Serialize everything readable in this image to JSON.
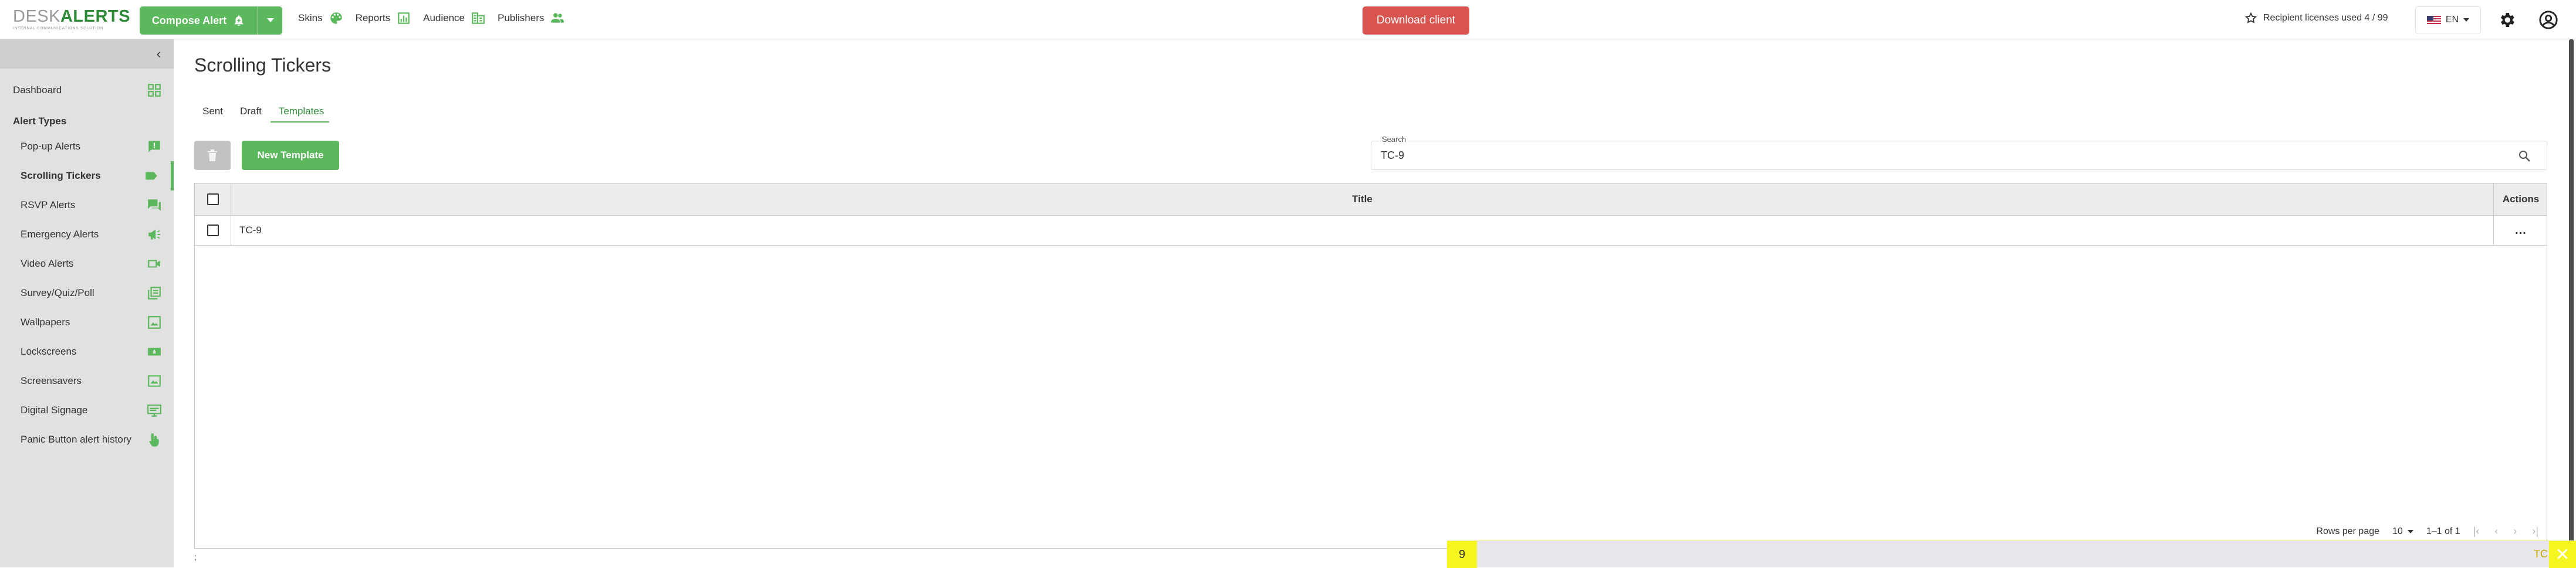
{
  "brand": {
    "logo_desk": "DESK",
    "logo_alerts": "ALERTS",
    "tagline": "INTERNAL COMMUNICATIONS SOLUTION",
    "accent": "#5cb85c",
    "danger": "#d9534f"
  },
  "topbar": {
    "compose_label": "Compose Alert",
    "nav": [
      {
        "label": "Skins",
        "icon": "palette-icon"
      },
      {
        "label": "Reports",
        "icon": "chart-icon"
      },
      {
        "label": "Audience",
        "icon": "building-icon"
      },
      {
        "label": "Publishers",
        "icon": "people-icon"
      }
    ],
    "download_label": "Download client",
    "licenses_label": "Recipient licenses used 4 / 99",
    "language": "EN"
  },
  "sidebar": {
    "dashboard": "Dashboard",
    "section_title": "Alert Types",
    "items": [
      {
        "label": "Pop-up Alerts",
        "icon": "popup-icon"
      },
      {
        "label": "Scrolling Tickers",
        "icon": "ticker-icon"
      },
      {
        "label": "RSVP Alerts",
        "icon": "rsvp-icon"
      },
      {
        "label": "Emergency Alerts",
        "icon": "megaphone-icon"
      },
      {
        "label": "Video Alerts",
        "icon": "video-icon"
      },
      {
        "label": "Survey/Quiz/Poll",
        "icon": "survey-icon"
      },
      {
        "label": "Wallpapers",
        "icon": "wallpaper-icon"
      },
      {
        "label": "Lockscreens",
        "icon": "lockscreen-icon"
      },
      {
        "label": "Screensavers",
        "icon": "screensaver-icon"
      },
      {
        "label": "Digital Signage",
        "icon": "signage-icon"
      },
      {
        "label": "Panic Button alert history",
        "icon": "hand-icon"
      }
    ]
  },
  "main": {
    "title": "Scrolling Tickers",
    "tabs": [
      {
        "label": "Sent"
      },
      {
        "label": "Draft"
      },
      {
        "label": "Templates"
      }
    ],
    "new_template_label": "New Template",
    "search": {
      "label": "Search",
      "value": "TC-9"
    },
    "table": {
      "columns": [
        "Title",
        "Actions"
      ],
      "rows": [
        {
          "title": "TC-9",
          "actions": "..."
        }
      ]
    },
    "pagination": {
      "rows_per_page_label": "Rows per page",
      "rows_per_page": "10",
      "range": "1–1 of 1"
    },
    "cursor_mark": ";"
  },
  "ticker": {
    "left_glyph": "9",
    "text": "TC"
  }
}
